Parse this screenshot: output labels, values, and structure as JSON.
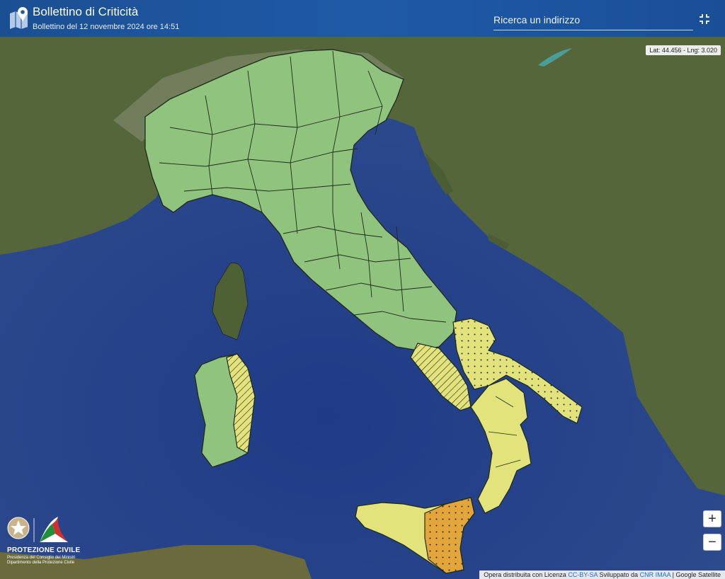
{
  "header": {
    "title": "Bollettino di Criticità",
    "subtitle": "Bollettino del 12 novembre 2024 ore 14:51",
    "search_placeholder": "Ricerca un indirizzo"
  },
  "map": {
    "coords_readout": "Lat: 44.456 - Lng: 3.020",
    "zoom_in_label": "+",
    "zoom_out_label": "−",
    "colors": {
      "green": "#8fc37e",
      "yellow": "#e3e37b",
      "orange": "#e2a63a",
      "sea": "#2b3f8a",
      "land": "#5b6b3a"
    }
  },
  "footer": {
    "text1": "Opera distribuita con Licenza",
    "license": "CC-BY-SA",
    "text2": "Sviluppato da",
    "developer": "CNR IMAA",
    "text3": "| Google Satellite"
  },
  "brand": {
    "name": "PROTEZIONE CIVILE",
    "line2": "Presidenza del Consiglio dei Ministri",
    "line3": "Dipartimento della Protezione Civile"
  }
}
